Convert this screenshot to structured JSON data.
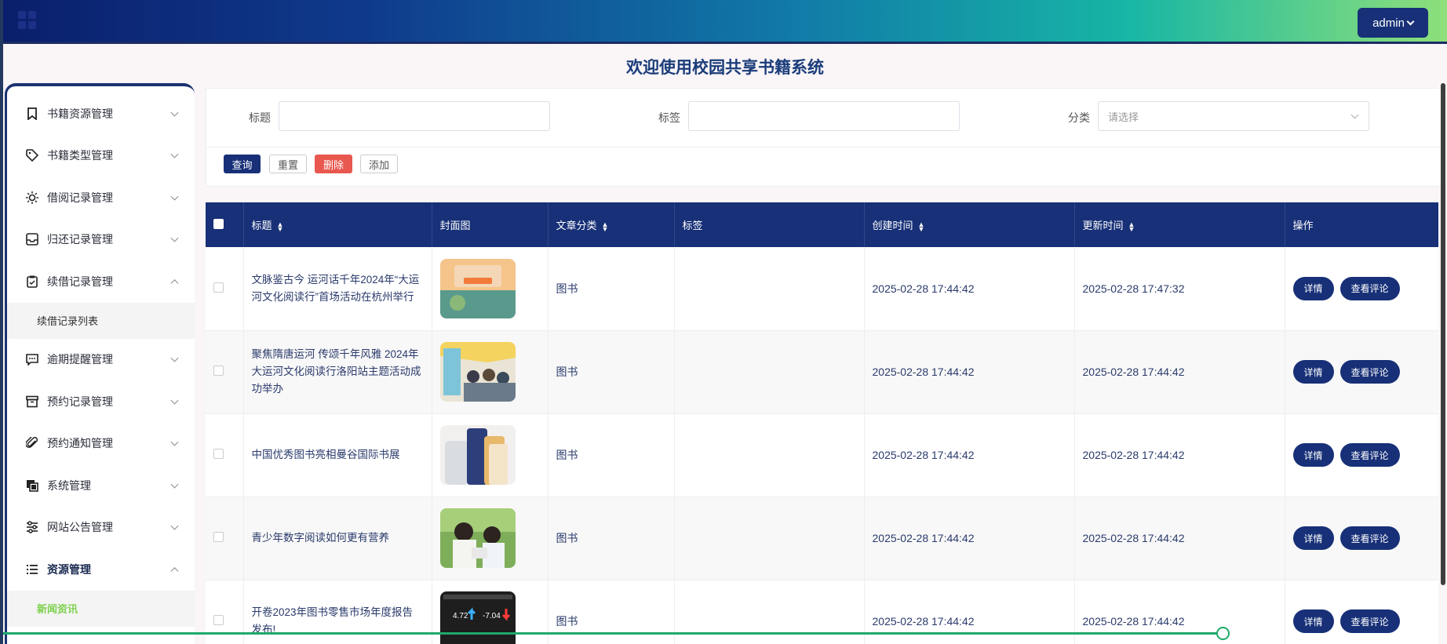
{
  "header": {
    "user": "admin"
  },
  "page_title": "欢迎使用校园共享书籍系统",
  "sidebar": {
    "items": [
      {
        "label": "书籍资源管理",
        "icon": "bookmark-icon",
        "expanded": false
      },
      {
        "label": "书籍类型管理",
        "icon": "tag-icon",
        "expanded": false
      },
      {
        "label": "借阅记录管理",
        "icon": "sun-icon",
        "expanded": false
      },
      {
        "label": "归还记录管理",
        "icon": "inbox-icon",
        "expanded": false
      },
      {
        "label": "续借记录管理",
        "icon": "clipboard-icon",
        "expanded": true,
        "children": [
          "续借记录列表"
        ]
      },
      {
        "label": "逾期提醒管理",
        "icon": "message-icon",
        "expanded": false
      },
      {
        "label": "预约记录管理",
        "icon": "archive-icon",
        "expanded": false
      },
      {
        "label": "预约通知管理",
        "icon": "paperclip-icon",
        "expanded": false
      },
      {
        "label": "系统管理",
        "icon": "copy-icon",
        "expanded": false
      },
      {
        "label": "网站公告管理",
        "icon": "sliders-icon",
        "expanded": false
      },
      {
        "label": "资源管理",
        "icon": "list-icon",
        "expanded": true,
        "children": [
          "新闻资讯"
        ]
      }
    ]
  },
  "search": {
    "title_label": "标题",
    "tag_label": "标签",
    "category_label": "分类",
    "category_placeholder": "请选择",
    "query_btn": "查询",
    "reset_btn": "重置",
    "delete_btn": "删除",
    "add_btn": "添加"
  },
  "table": {
    "headers": [
      "标题",
      "封面图",
      "文章分类",
      "标签",
      "创建时间",
      "更新时间",
      "操作"
    ],
    "rows": [
      {
        "title": "文脉鉴古今 运河话千年2024年“大运河文化阅读行”首场活动在杭州举行",
        "category": "图书",
        "tags": "",
        "created": "2025-02-28 17:44:42",
        "updated": "2025-02-28 17:47:32"
      },
      {
        "title": "聚焦隋唐运河 传颂千年风雅 2024年大运河文化阅读行洛阳站主题活动成功举办",
        "category": "图书",
        "tags": "",
        "created": "2025-02-28 17:44:42",
        "updated": "2025-02-28 17:44:42"
      },
      {
        "title": "中国优秀图书亮相曼谷国际书展",
        "category": "图书",
        "tags": "",
        "created": "2025-02-28 17:44:42",
        "updated": "2025-02-28 17:44:42"
      },
      {
        "title": "青少年数字阅读如何更有营养",
        "category": "图书",
        "tags": "",
        "created": "2025-02-28 17:44:42",
        "updated": "2025-02-28 17:44:42"
      },
      {
        "title": "开卷2023年图书零售市场年度报告发布!",
        "category": "图书",
        "tags": "",
        "created": "2025-02-28 17:44:42",
        "updated": "2025-02-28 17:44:42"
      }
    ],
    "detail_btn": "详情",
    "comment_btn": "查看评论",
    "thumb5_left": "4.72",
    "thumb5_right": "-7.04"
  }
}
